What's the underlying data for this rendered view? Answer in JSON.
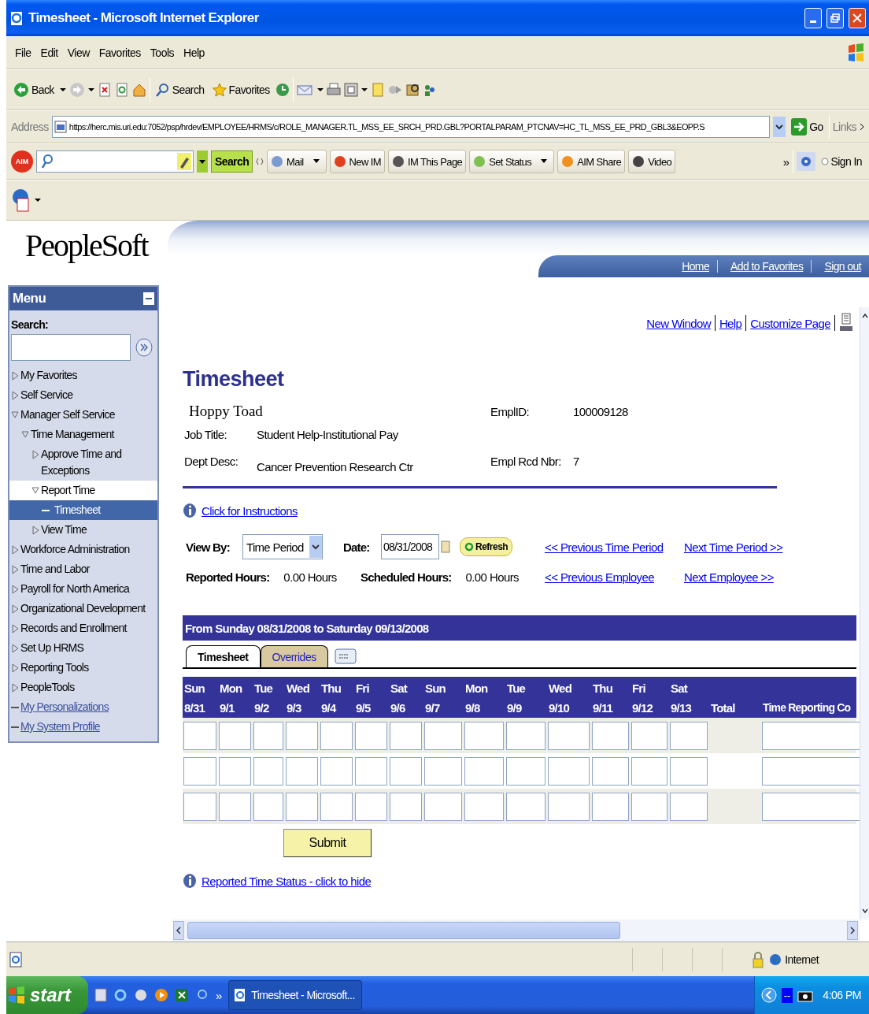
{
  "window": {
    "title": "Timesheet - Microsoft Internet Explorer"
  },
  "menu_bar": [
    "File",
    "Edit",
    "View",
    "Favorites",
    "Tools",
    "Help"
  ],
  "toolbar": {
    "back": "Back",
    "search": "Search",
    "favorites": "Favorites"
  },
  "address_bar": {
    "label": "Address",
    "url": "https://herc.mis.uri.edu:7052/psp/hrdev/EMPLOYEE/HRMS/c/ROLE_MANAGER.TL_MSS_EE_SRCH_PRD.GBL?PORTALPARAM_PTCNAV=HC_TL_MSS_EE_PRD_GBL3&EOPP.S",
    "go": "Go",
    "links": "Links"
  },
  "aim_toolbar": {
    "logo": "AIM",
    "search_button": "Search",
    "items": [
      {
        "label": "Mail",
        "dropdown": true
      },
      {
        "label": "New IM",
        "dropdown": false
      },
      {
        "label": "IM This Page",
        "dropdown": false
      },
      {
        "label": "Set Status",
        "dropdown": true
      },
      {
        "label": "AIM Share",
        "dropdown": false
      },
      {
        "label": "Video",
        "dropdown": false
      }
    ],
    "more": "»",
    "sign_in": "Sign In"
  },
  "banner": {
    "logo": "PeopleSoft",
    "links": [
      "Home",
      "Add to Favorites",
      "Sign out"
    ]
  },
  "sidebar": {
    "title": "Menu",
    "search_label": "Search:",
    "items": [
      {
        "label": "My Favorites",
        "kind": "folder",
        "expanded": false,
        "selected": false
      },
      {
        "label": "Self Service",
        "kind": "folder",
        "expanded": false,
        "selected": false
      },
      {
        "label": "Manager Self Service",
        "kind": "folder",
        "expanded": true,
        "selected": false,
        "children": [
          {
            "label": "Time Management",
            "kind": "folder",
            "expanded": true,
            "selected": false,
            "children": [
              {
                "label": "Approve Time and Exceptions",
                "kind": "folder",
                "expanded": false,
                "selected": false
              },
              {
                "label": "Report Time",
                "kind": "folder",
                "expanded": true,
                "selected": false,
                "children": [
                  {
                    "label": "Timesheet",
                    "kind": "page",
                    "selected": true
                  }
                ]
              },
              {
                "label": "View Time",
                "kind": "folder",
                "expanded": false,
                "selected": false
              }
            ]
          }
        ]
      },
      {
        "label": "Workforce Administration",
        "kind": "folder",
        "expanded": false,
        "selected": false
      },
      {
        "label": "Time and Labor",
        "kind": "folder",
        "expanded": false,
        "selected": false
      },
      {
        "label": "Payroll for North America",
        "kind": "folder",
        "expanded": false,
        "selected": false
      },
      {
        "label": "Organizational Development",
        "kind": "folder",
        "expanded": false,
        "selected": false
      },
      {
        "label": "Records and Enrollment",
        "kind": "folder",
        "expanded": false,
        "selected": false
      },
      {
        "label": "Set Up HRMS",
        "kind": "folder",
        "expanded": false,
        "selected": false
      },
      {
        "label": "Reporting Tools",
        "kind": "folder",
        "expanded": false,
        "selected": false
      },
      {
        "label": "PeopleTools",
        "kind": "folder",
        "expanded": false,
        "selected": false
      },
      {
        "label": "My Personalizations",
        "kind": "link",
        "selected": false
      },
      {
        "label": "My System Profile",
        "kind": "link",
        "selected": false
      }
    ]
  },
  "page_links": [
    "New Window",
    "Help",
    "Customize Page"
  ],
  "page": {
    "title": "Timesheet",
    "employee_name": "Hoppy Toad",
    "fields": [
      {
        "label": "EmplID:",
        "value": "100009128"
      },
      {
        "label": "Job Title:",
        "value": "Student Help-Institutional Pay"
      },
      {
        "label": "Dept Desc:",
        "value": "Cancer Prevention Research Ctr"
      },
      {
        "label": "Empl Rcd Nbr:",
        "value": "7"
      }
    ],
    "instructions_link": "Click for Instructions",
    "view_by": {
      "label": "View By:",
      "value": "Time Period"
    },
    "date": {
      "label": "Date:",
      "value": "08/31/2008"
    },
    "refresh": "Refresh",
    "reported_hours": {
      "label": "Reported Hours:",
      "value": "0.00 Hours"
    },
    "scheduled_hours": {
      "label": "Scheduled Hours:",
      "value": "0.00 Hours"
    },
    "nav_links": [
      "<< Previous Time Period",
      "Next Time Period >>",
      "<< Previous Employee",
      "Next Employee >>"
    ],
    "period_header": "From Sunday 08/31/2008 to Saturday 09/13/2008",
    "tabs": [
      {
        "label": "Timesheet",
        "selected": true
      },
      {
        "label": "Overrides",
        "selected": false
      }
    ],
    "columns": [
      {
        "day": "Sun",
        "date": "8/31"
      },
      {
        "day": "Mon",
        "date": "9/1"
      },
      {
        "day": "Tue",
        "date": "9/2"
      },
      {
        "day": "Wed",
        "date": "9/3"
      },
      {
        "day": "Thu",
        "date": "9/4"
      },
      {
        "day": "Fri",
        "date": "9/5"
      },
      {
        "day": "Sat",
        "date": "9/6"
      },
      {
        "day": "Sun",
        "date": "9/7"
      },
      {
        "day": "Mon",
        "date": "9/8"
      },
      {
        "day": "Tue",
        "date": "9/9"
      },
      {
        "day": "Wed",
        "date": "9/10"
      },
      {
        "day": "Thu",
        "date": "9/11"
      },
      {
        "day": "Fri",
        "date": "9/12"
      },
      {
        "day": "Sat",
        "date": "9/13"
      }
    ],
    "total_column": "Total",
    "trc_column": "Time Reporting Co",
    "rows": [
      {
        "shaded": true
      },
      {
        "shaded": false
      },
      {
        "shaded": true
      }
    ],
    "submit": "Submit",
    "status_link": "Reported Time Status - click to hide"
  },
  "status_bar": {
    "zone": "Internet"
  },
  "taskbar": {
    "start": "start",
    "more": "»",
    "task": "Timesheet - Microsoft...",
    "tray_badge": "--",
    "clock": "4:06 PM"
  }
}
